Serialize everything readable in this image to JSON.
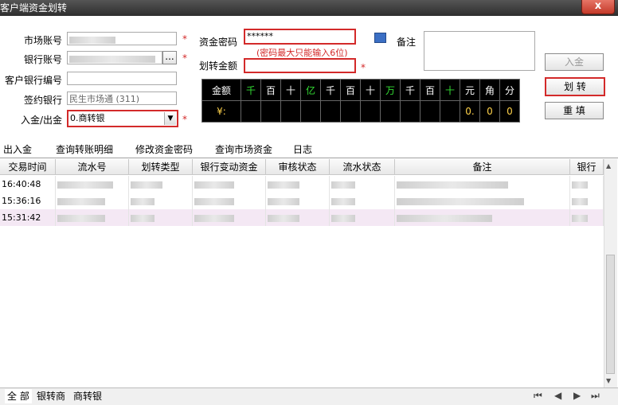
{
  "window": {
    "title": "客户端资金划转",
    "close_label": "x"
  },
  "form": {
    "market_account_label": "市场账号",
    "bank_account_label": "银行账号",
    "customer_bank_no_label": "客户银行编号",
    "signed_bank_label": "签约银行",
    "signed_bank_value": "民生市场通 (311)",
    "direction_label": "入金/出金",
    "direction_value": "0.商转银",
    "password_label": "资金密码",
    "password_value": "******",
    "password_hint": "(密码最大只能输入6位)",
    "amount_label": "划转金额",
    "remark_label": "备注",
    "required_mark": "*",
    "bank_account_btn": "..."
  },
  "buttons": {
    "deposit": "入金",
    "transfer": "划 转",
    "reset": "重 填"
  },
  "amount_grid": {
    "header_label": "金额",
    "value_label": "¥:",
    "units": [
      "千",
      "百",
      "十",
      "亿",
      "千",
      "百",
      "十",
      "万",
      "千",
      "百",
      "十",
      "元",
      "角",
      "分"
    ],
    "unit_colors": [
      "#33dd33",
      "#ffffff",
      "#ffffff",
      "#33dd33",
      "#ffffff",
      "#ffffff",
      "#ffffff",
      "#33dd33",
      "#ffffff",
      "#ffffff",
      "#33dd33",
      "#ffffff",
      "#ffffff",
      "#ffffff"
    ],
    "values": [
      "",
      "",
      "",
      "",
      "",
      "",
      "",
      "",
      "",
      "",
      "",
      "0.",
      "0",
      "0"
    ],
    "accent": "#ffd24a"
  },
  "tabs": [
    "出入金",
    "查询转账明细",
    "修改资金密码",
    "查询市场资金",
    "日志"
  ],
  "table": {
    "columns": [
      "交易时间",
      "流水号",
      "划转类型",
      "银行变动资金",
      "审核状态",
      "流水状态",
      "备注",
      "银行"
    ],
    "rows": [
      {
        "time": "16:40:48"
      },
      {
        "time": "15:36:16"
      },
      {
        "time": "15:31:42"
      }
    ]
  },
  "filter_tabs": [
    "全 部",
    "银转商",
    "商转银"
  ],
  "nav": {
    "first": "⏮",
    "prev": "◀",
    "next": "▶",
    "last": "⏭"
  }
}
